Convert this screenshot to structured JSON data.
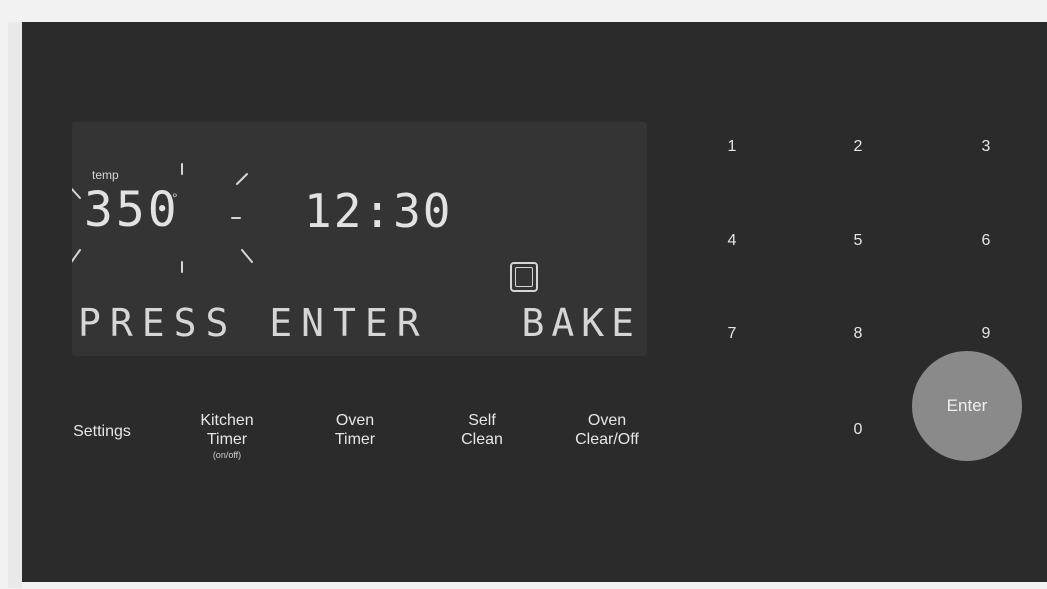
{
  "display": {
    "temp_label": "temp",
    "temp_value": "350",
    "degree_symbol": "°",
    "clock": "12:30",
    "status_text": "PRESS ENTER",
    "mode_text": "BAKE"
  },
  "function_buttons": {
    "settings": "Settings",
    "kitchen_timer_line1": "Kitchen",
    "kitchen_timer_line2": "Timer",
    "kitchen_timer_sub": "(on/off)",
    "oven_timer_line1": "Oven",
    "oven_timer_line2": "Timer",
    "self_clean_line1": "Self",
    "self_clean_line2": "Clean",
    "oven_clear_line1": "Oven",
    "oven_clear_line2": "Clear/Off"
  },
  "keypad": {
    "k1": "1",
    "k2": "2",
    "k3": "3",
    "k4": "4",
    "k5": "5",
    "k6": "6",
    "k7": "7",
    "k8": "8",
    "k9": "9",
    "k0": "0",
    "enter": "Enter"
  },
  "icons": {
    "oven": "oven-icon",
    "flash": "blinking-rays-icon"
  },
  "colors": {
    "panel": "#2b2b2b",
    "display": "#343434",
    "segment": "#d6d6d6",
    "enter_button": "#8a8a8a"
  }
}
